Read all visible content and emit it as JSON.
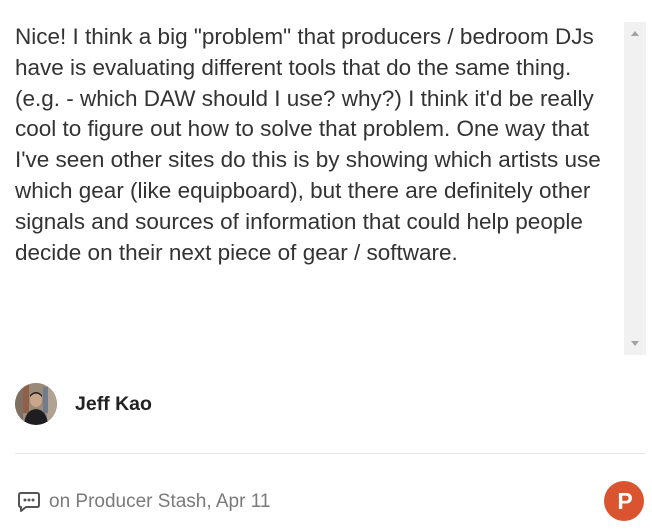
{
  "comment": {
    "text": "Nice! I think a big \"problem\" that producers / bedroom DJs have is evaluating different tools that do the same thing. (e.g. - which DAW should I use? why?) I think it'd be really cool to figure out how to solve that problem. One way that I've seen other sites do this is by showing which artists use which gear (like equipboard), but there are definitely other signals and sources of information that could help people decide on their next piece of gear / software."
  },
  "author": {
    "name": "Jeff Kao"
  },
  "footer": {
    "source_text": "on Producer Stash, Apr 11"
  },
  "brand": {
    "logo_letter": "P",
    "accent_color": "#da552f"
  },
  "icons": {
    "comment": "speech-bubble-icon",
    "scroll_up": "triangle-up-icon",
    "scroll_down": "triangle-down-icon"
  }
}
